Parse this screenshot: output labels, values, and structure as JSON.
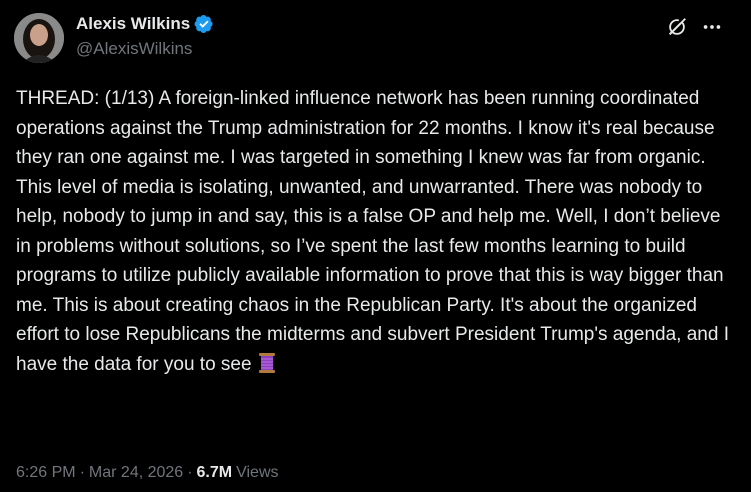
{
  "author": {
    "display_name": "Alexis Wilkins",
    "handle": "@AlexisWilkins",
    "verified": true
  },
  "tweet": {
    "text": "THREAD: (1/13) A foreign-linked influence network has been running coordinated operations against the Trump administration for 22 months. I know it's real because they ran one against me. I was targeted in something I knew was far from organic. This level of media is isolating, unwanted, and unwarranted. There was nobody to help, nobody to jump in and say, this is a false OP and help me. Well, I don’t believe in problems without solutions, so I’ve spent the last few months learning to build programs to utilize publicly available information to prove that this is way bigger than me. This is about creating chaos in the Republican Party. It's about the organized effort to lose Republicans the midterms and subvert President Trump's agenda, and I have the data for you to see",
    "trailing_emoji": "thread-spool-emoji"
  },
  "meta": {
    "time": "6:26 PM",
    "separator": "·",
    "date": "Mar 24, 2026",
    "views_count": "6.7M",
    "views_label": "Views"
  },
  "icons": {
    "verified": "verified-badge-icon",
    "grok": "grok-icon",
    "more": "more-options-icon"
  },
  "colors": {
    "background": "#000000",
    "text": "#e7e9ea",
    "secondary": "#71767b",
    "verified_blue": "#1d9bf0"
  }
}
